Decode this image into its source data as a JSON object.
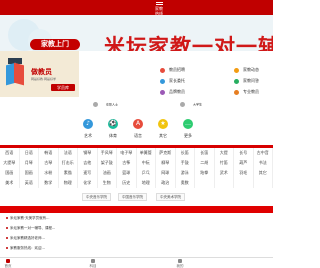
{
  "topbar": {
    "menu_label_1": "家教",
    "menu_label_2": "热线"
  },
  "banner": {
    "pill_label": "家教上门",
    "slogan": "米坛家教一对一辅"
  },
  "promo": {
    "title": "做教员",
    "desc": "网是好教·网是好学",
    "button": "学员库"
  },
  "quick": [
    {
      "label": "教员招聘",
      "color": "#e74c3c"
    },
    {
      "label": "家教动态",
      "color": "#f39c12"
    },
    {
      "label": "家长委托",
      "color": "#3498db"
    },
    {
      "label": "家教问答",
      "color": "#27ae60"
    },
    {
      "label": "品牌教员",
      "color": "#9b59b6"
    },
    {
      "label": "专业教员",
      "color": "#e67e22"
    }
  ],
  "row_small": {
    "left": "在职人士",
    "right": "大学生"
  },
  "icons": [
    {
      "label": "艺术",
      "color": "#3498db",
      "glyph": "♪"
    },
    {
      "label": "体育",
      "color": "#1abc9c",
      "glyph": "⚽"
    },
    {
      "label": "语言",
      "color": "#e74c3c",
      "glyph": "A"
    },
    {
      "label": "其它",
      "color": "#f1c40f",
      "glyph": "★"
    },
    {
      "label": "更多",
      "color": "#2ecc71",
      "glyph": "…"
    }
  ],
  "subjects": [
    [
      "西语",
      "日语",
      "韩语",
      "法语",
      "钢琴",
      "手风琴",
      "电子琴",
      "单簧管",
      "萨克斯",
      "长笛",
      "长笛",
      "大提",
      "长号",
      "古中音"
    ],
    [
      "大提琴",
      "月琴",
      "古琴",
      "打击乐",
      "吉他",
      "架子鼓",
      "古筝",
      "中阮",
      "柳琴",
      "手鼓",
      "二胡",
      "竹笛",
      "葫芦",
      "书法"
    ],
    [
      "国画",
      "国画",
      "水粉",
      "素描",
      "速写",
      "油画",
      "篮球",
      "乒乓",
      "网球",
      "游泳",
      "跆拳",
      "武术",
      "羽毛",
      "其它"
    ],
    [
      "美术",
      "英语",
      "数学",
      "物理",
      "化学",
      "生物",
      "历史",
      "地理",
      "政治",
      "奥数",
      "",
      "",
      "",
      ""
    ]
  ],
  "links": [
    "中央音乐学院",
    "中国音乐学院",
    "中央美术学院"
  ],
  "news": [
    "米坛家教·天美学员就有...",
    "米坛家教一对一辅导、课程...",
    "米坛家教精选好老师...",
    "家教服务热线：欢迎..."
  ],
  "tabs": [
    {
      "label": "首页",
      "color": "#c00000"
    },
    {
      "label": "科目",
      "color": "#888888"
    },
    {
      "label": "我的",
      "color": "#888888"
    }
  ]
}
